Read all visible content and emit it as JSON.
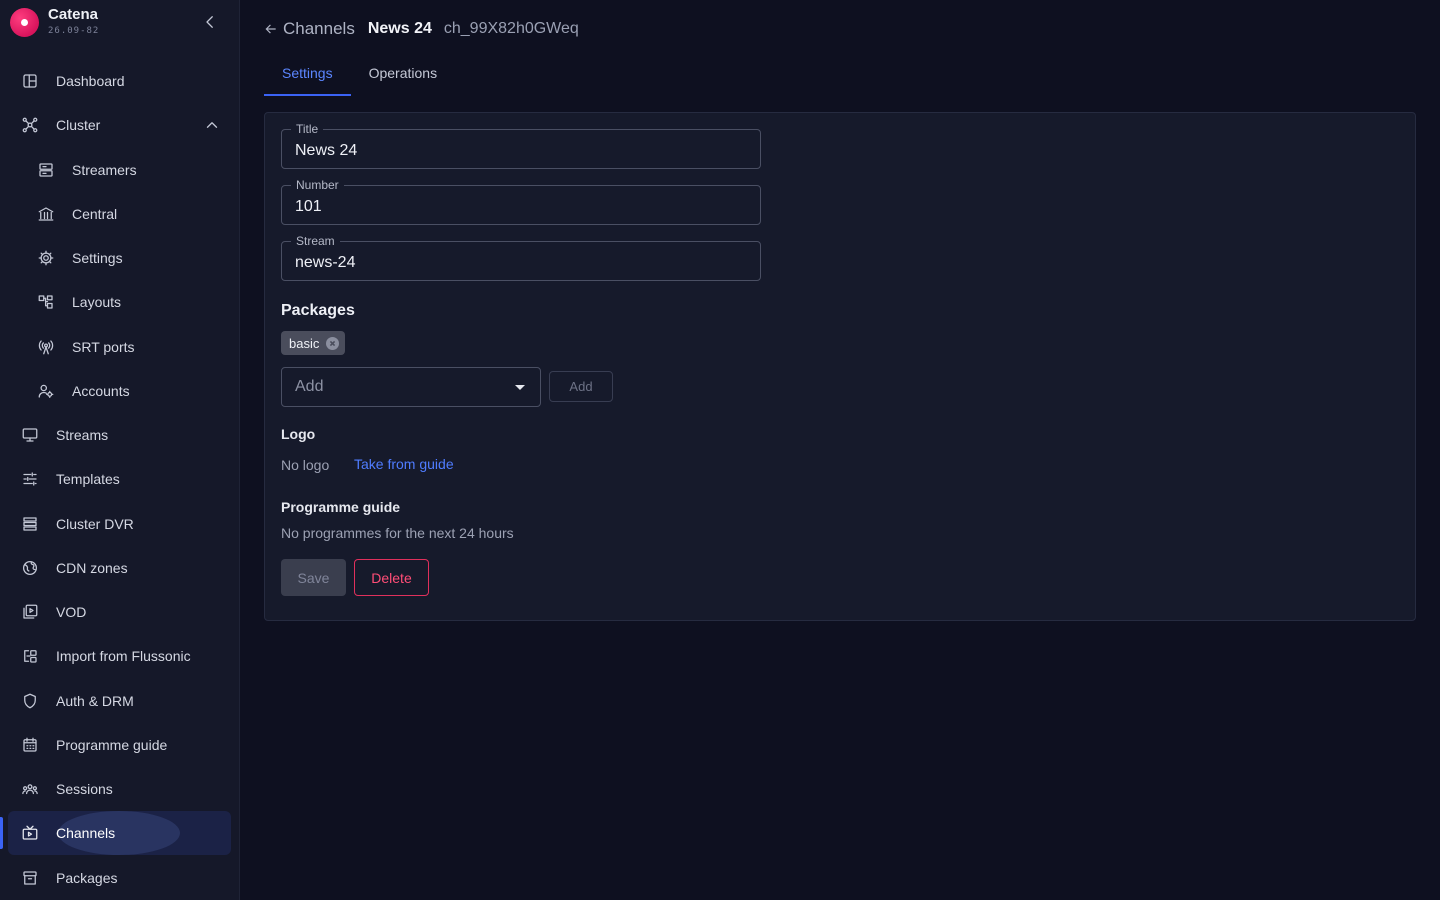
{
  "brand": {
    "name": "Catena",
    "version": "26.09-82"
  },
  "sidebar": {
    "items": [
      {
        "label": "Dashboard",
        "icon": "dashboard-icon"
      },
      {
        "label": "Cluster",
        "icon": "cluster-icon"
      },
      {
        "label": "Streamers",
        "icon": "streamers-icon"
      },
      {
        "label": "Central",
        "icon": "central-icon"
      },
      {
        "label": "Settings",
        "icon": "gear-icon"
      },
      {
        "label": "Layouts",
        "icon": "layouts-icon"
      },
      {
        "label": "SRT ports",
        "icon": "antenna-icon"
      },
      {
        "label": "Accounts",
        "icon": "accounts-icon"
      },
      {
        "label": "Streams",
        "icon": "monitor-icon"
      },
      {
        "label": "Templates",
        "icon": "sliders-icon"
      },
      {
        "label": "Cluster DVR",
        "icon": "dvr-icon"
      },
      {
        "label": "CDN zones",
        "icon": "globe-icon"
      },
      {
        "label": "VOD",
        "icon": "vod-icon"
      },
      {
        "label": "Import from Flussonic",
        "icon": "import-icon"
      },
      {
        "label": "Auth & DRM",
        "icon": "shield-icon"
      },
      {
        "label": "Programme guide",
        "icon": "calendar-icon"
      },
      {
        "label": "Sessions",
        "icon": "users-icon"
      },
      {
        "label": "Channels",
        "icon": "tv-icon"
      },
      {
        "label": "Packages",
        "icon": "package-icon"
      }
    ],
    "active": "Channels"
  },
  "breadcrumb": {
    "back_label": "Channels",
    "title": "News 24",
    "id": "ch_99X82h0GWeq"
  },
  "tabs": [
    {
      "label": "Settings",
      "active": true
    },
    {
      "label": "Operations",
      "active": false
    }
  ],
  "form": {
    "title": {
      "label": "Title",
      "value": "News 24"
    },
    "number": {
      "label": "Number",
      "value": "101"
    },
    "stream": {
      "label": "Stream",
      "value": "news-24"
    },
    "packages": {
      "heading": "Packages",
      "chips": [
        "basic"
      ],
      "select_placeholder": "Add",
      "add_button": "Add"
    },
    "logo": {
      "heading": "Logo",
      "value": "No logo",
      "link": "Take from guide"
    },
    "guide": {
      "heading": "Programme guide",
      "value": "No programmes for the next 24 hours"
    },
    "save_button": "Save",
    "delete_button": "Delete"
  },
  "colors": {
    "accent": "#3b63f5",
    "danger": "#e0305c",
    "brand": "#e8195f"
  }
}
